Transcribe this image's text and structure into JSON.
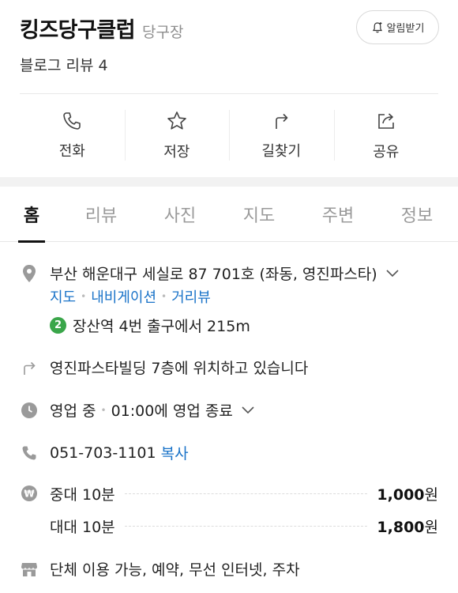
{
  "header": {
    "title": "킹즈당구클럽",
    "category": "당구장",
    "alarm_label": "알림받기",
    "review": "블로그 리뷰 4"
  },
  "actions": [
    {
      "label": "전화",
      "icon": "phone-icon"
    },
    {
      "label": "저장",
      "icon": "star-icon"
    },
    {
      "label": "길찾기",
      "icon": "directions-icon"
    },
    {
      "label": "공유",
      "icon": "share-icon"
    }
  ],
  "tabs": [
    "홈",
    "리뷰",
    "사진",
    "지도",
    "주변",
    "정보"
  ],
  "active_tab": "홈",
  "info": {
    "address": "부산 해운대구 세실로 87 701호 (좌동, 영진파스타)",
    "map_links": [
      "지도",
      "내비게이션",
      "거리뷰"
    ],
    "subway_line": "2",
    "subway_text": "장산역 4번 출구에서 215m",
    "location_note": "영진파스타빌딩 7층에 위치하고 있습니다",
    "status": "영업 중",
    "hours": "01:00에 영업 종료",
    "phone": "051-703-1101",
    "copy_label": "복사",
    "prices": [
      {
        "name": "중대 10분",
        "amount": "1,000",
        "unit": "원"
      },
      {
        "name": "대대 10분",
        "amount": "1,800",
        "unit": "원"
      }
    ],
    "amenities": "단체 이용 가능, 예약, 무선 인터넷, 주차"
  },
  "colors": {
    "link": "#1a73c8",
    "subway_line2": "#3aa64a",
    "icon": "#9a9a9a"
  }
}
